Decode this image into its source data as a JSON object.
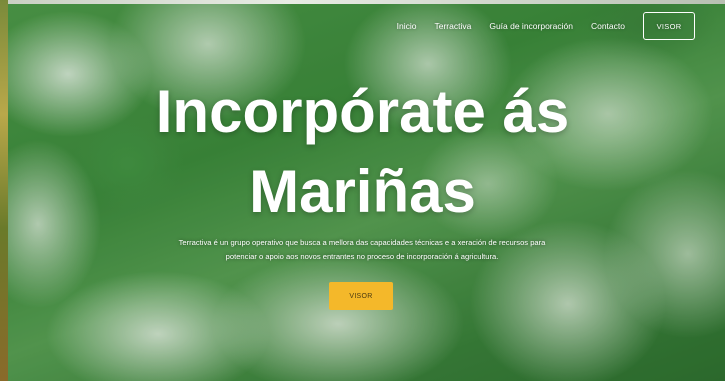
{
  "nav": {
    "items": [
      {
        "label": "Inicio"
      },
      {
        "label": "Terractiva"
      },
      {
        "label": "Guía de incorporación"
      },
      {
        "label": "Contacto"
      }
    ],
    "visor_button": "VISOR"
  },
  "hero": {
    "title_line1": "Incorpórate ás",
    "title_line2": "Mariñas",
    "description_line1": "Terractiva é un grupo operativo que busca a mellora das capacidades técnicas e a xeración de recursos para",
    "description_line2": "potenciar o apoio aos novos entrantes no proceso de incorporación á agricultura.",
    "cta_label": "VISOR"
  },
  "colors": {
    "accent": "#f4b82a",
    "text": "#ffffff"
  }
}
